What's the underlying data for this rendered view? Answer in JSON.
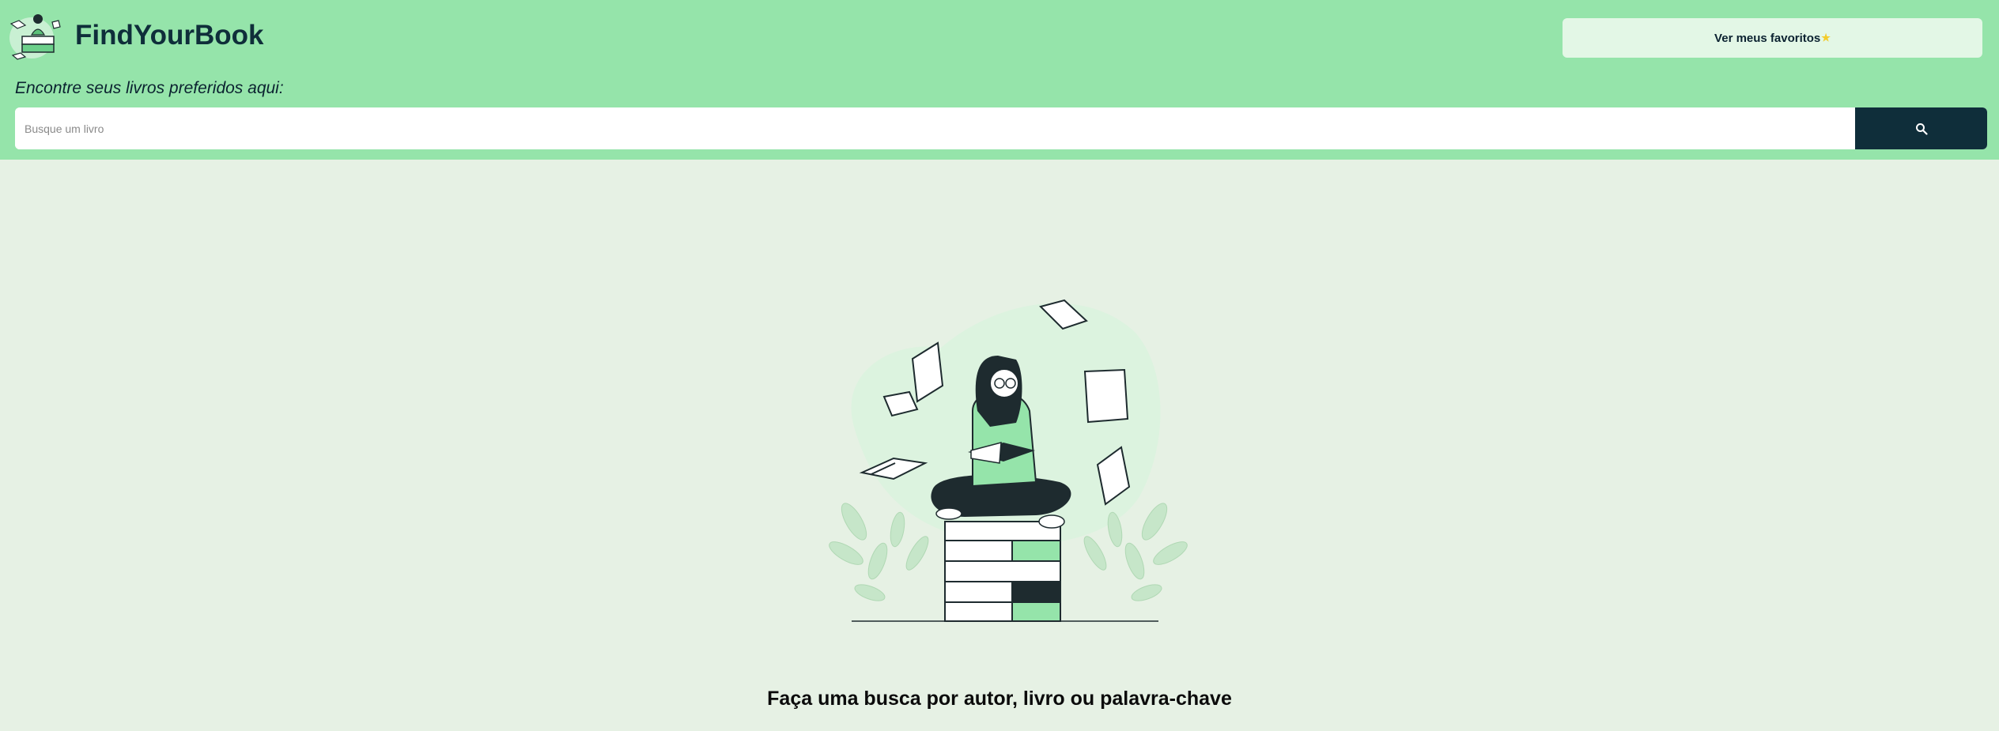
{
  "header": {
    "app_title": "FindYourBook",
    "favorites_label": "Ver meus favoritos",
    "favorites_icon": "star-icon",
    "subtitle": "Encontre seus livros preferidos aqui:"
  },
  "search": {
    "placeholder": "Busque um livro",
    "value": "",
    "button_icon": "search-icon"
  },
  "main": {
    "illustration": "woman-reading-on-books-illustration",
    "hint": "Faça uma busca por autor, livro ou palavra-chave"
  },
  "colors": {
    "header_bg": "#95e4aa",
    "page_bg": "#e6f1e4",
    "dark_accent": "#0f2e3a",
    "star": "#f3cc2a"
  }
}
